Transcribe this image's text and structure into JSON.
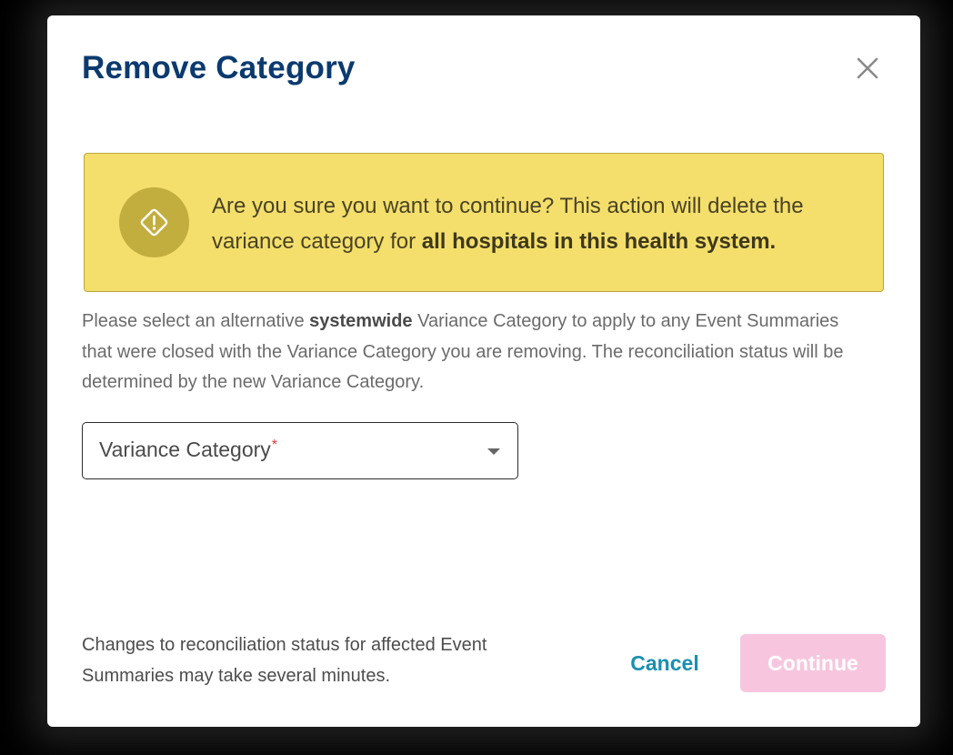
{
  "modal": {
    "title": "Remove Category",
    "close_icon": "close-icon"
  },
  "warning": {
    "icon": "warning-diamond-icon",
    "text_prefix": "Are you sure you want to continue? This action will delete the variance category for ",
    "text_bold": "all hospitals in this health system."
  },
  "description": {
    "part1": "Please select an alternative ",
    "bold": "systemwide",
    "part2": " Variance Category to apply to any Event Summaries that were closed with the Variance Category you are removing. The reconciliation status will be determined by the new Variance Category."
  },
  "select": {
    "label": "Variance Category",
    "required_marker": "*",
    "icon": "caret-down-icon"
  },
  "footer": {
    "note": "Changes to reconciliation status for affected Event Summaries may take several minutes.",
    "cancel_label": "Cancel",
    "continue_label": "Continue"
  },
  "colors": {
    "title": "#0b3a6f",
    "warning_bg": "#f4df6c",
    "warning_circle": "#c2ad3f",
    "cancel_text": "#1a8fb0",
    "continue_disabled_bg": "#f7c6de",
    "required": "#e53935"
  }
}
